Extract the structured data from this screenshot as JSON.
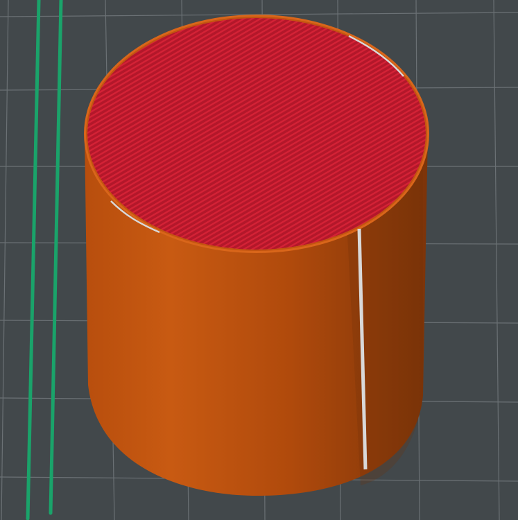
{
  "viewport": {
    "background_color": "#42484b",
    "grid_color": "#6a7074"
  },
  "scene": {
    "cylinder": {
      "wall_color": "#c2550f",
      "wall_shadow_color": "#7a3108",
      "top_surface_color": "#b8192a",
      "top_rim_color": "#e06a18",
      "seam_color": "#d9d9d9"
    },
    "travel_lines": {
      "color": "#1aa36a",
      "count": 2
    }
  }
}
